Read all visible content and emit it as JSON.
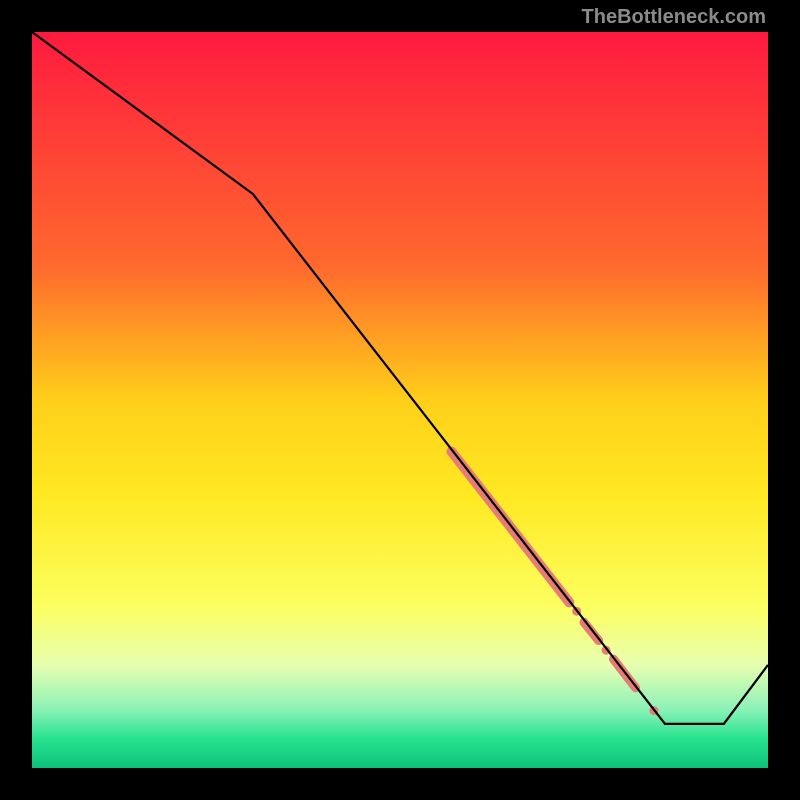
{
  "watermark": "TheBottleneck.com",
  "chart_data": {
    "type": "line",
    "title": "",
    "xlabel": "",
    "ylabel": "",
    "xlim": [
      0,
      100
    ],
    "ylim": [
      0,
      100
    ],
    "background": {
      "type": "vertical-gradient",
      "stops": [
        {
          "pos": 0.0,
          "color": "#ff1a3f"
        },
        {
          "pos": 0.32,
          "color": "#ff6a2d"
        },
        {
          "pos": 0.5,
          "color": "#ffcf1a"
        },
        {
          "pos": 0.63,
          "color": "#ffe921"
        },
        {
          "pos": 0.78,
          "color": "#fcff60"
        },
        {
          "pos": 0.86,
          "color": "#e7ffb0"
        },
        {
          "pos": 0.92,
          "color": "#8cf2b8"
        },
        {
          "pos": 0.96,
          "color": "#28e28f"
        },
        {
          "pos": 1.0,
          "color": "#0cc279"
        }
      ]
    },
    "series": [
      {
        "name": "bottleneck-curve",
        "x": [
          0,
          30,
          86,
          94,
          100
        ],
        "y": [
          100,
          78,
          6,
          6,
          14
        ]
      }
    ],
    "highlight_segments": [
      {
        "x0": 57,
        "y0": 43.0,
        "x1": 73,
        "y1": 22.5,
        "thickness": 10
      },
      {
        "x0": 75,
        "y0": 19.8,
        "x1": 77,
        "y1": 17.3,
        "thickness": 9
      },
      {
        "x0": 79,
        "y0": 14.8,
        "x1": 82,
        "y1": 10.9,
        "thickness": 9
      }
    ],
    "highlight_dots": [
      {
        "x": 74.0,
        "y": 21.3,
        "r": 4.5
      },
      {
        "x": 78.0,
        "y": 16.0,
        "r": 4.5
      },
      {
        "x": 84.5,
        "y": 7.8,
        "r": 4.5
      }
    ],
    "highlight_color": "#e77c77"
  }
}
